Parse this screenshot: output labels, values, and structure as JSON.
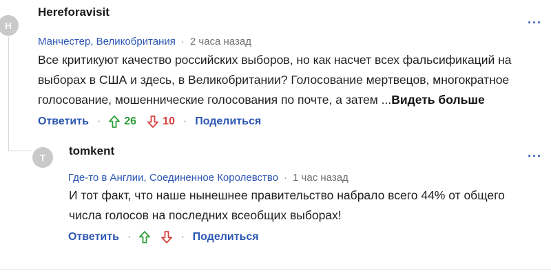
{
  "comments": [
    {
      "avatar_initial": "H",
      "username": "Hereforavisit",
      "location": "Манчестер, Великобритания",
      "time": "2 часа назад",
      "body_lines": [
        "Все критикуют качество российских выборов, но как насчет всех фальсификаций на",
        "выборах в США и здесь, в Великобритании? Голосование мертвецов, многократное",
        "голосование, мошеннические голосования по почте, а затем ..."
      ],
      "see_more": "Видеть больше",
      "reply_label": "Ответить",
      "upvotes": "26",
      "downvotes": "10",
      "share_label": "Поделиться",
      "more_icon": "···",
      "colors": {
        "upvote": "#2e9e3a",
        "downvote": "#d6403e",
        "link": "#2c56b3"
      }
    },
    {
      "avatar_initial": "T",
      "username": "tomkent",
      "location": "Где-то в Англии, Соединенное Королевство",
      "time": "1 час назад",
      "body_lines": [
        "И тот факт, что наше нынешнее правительство набрало всего 44% от общего",
        "числа голосов на последних всеобщих выборах!"
      ],
      "reply_label": "Ответить",
      "share_label": "Поделиться",
      "more_icon": "···"
    }
  ],
  "separator": "·"
}
